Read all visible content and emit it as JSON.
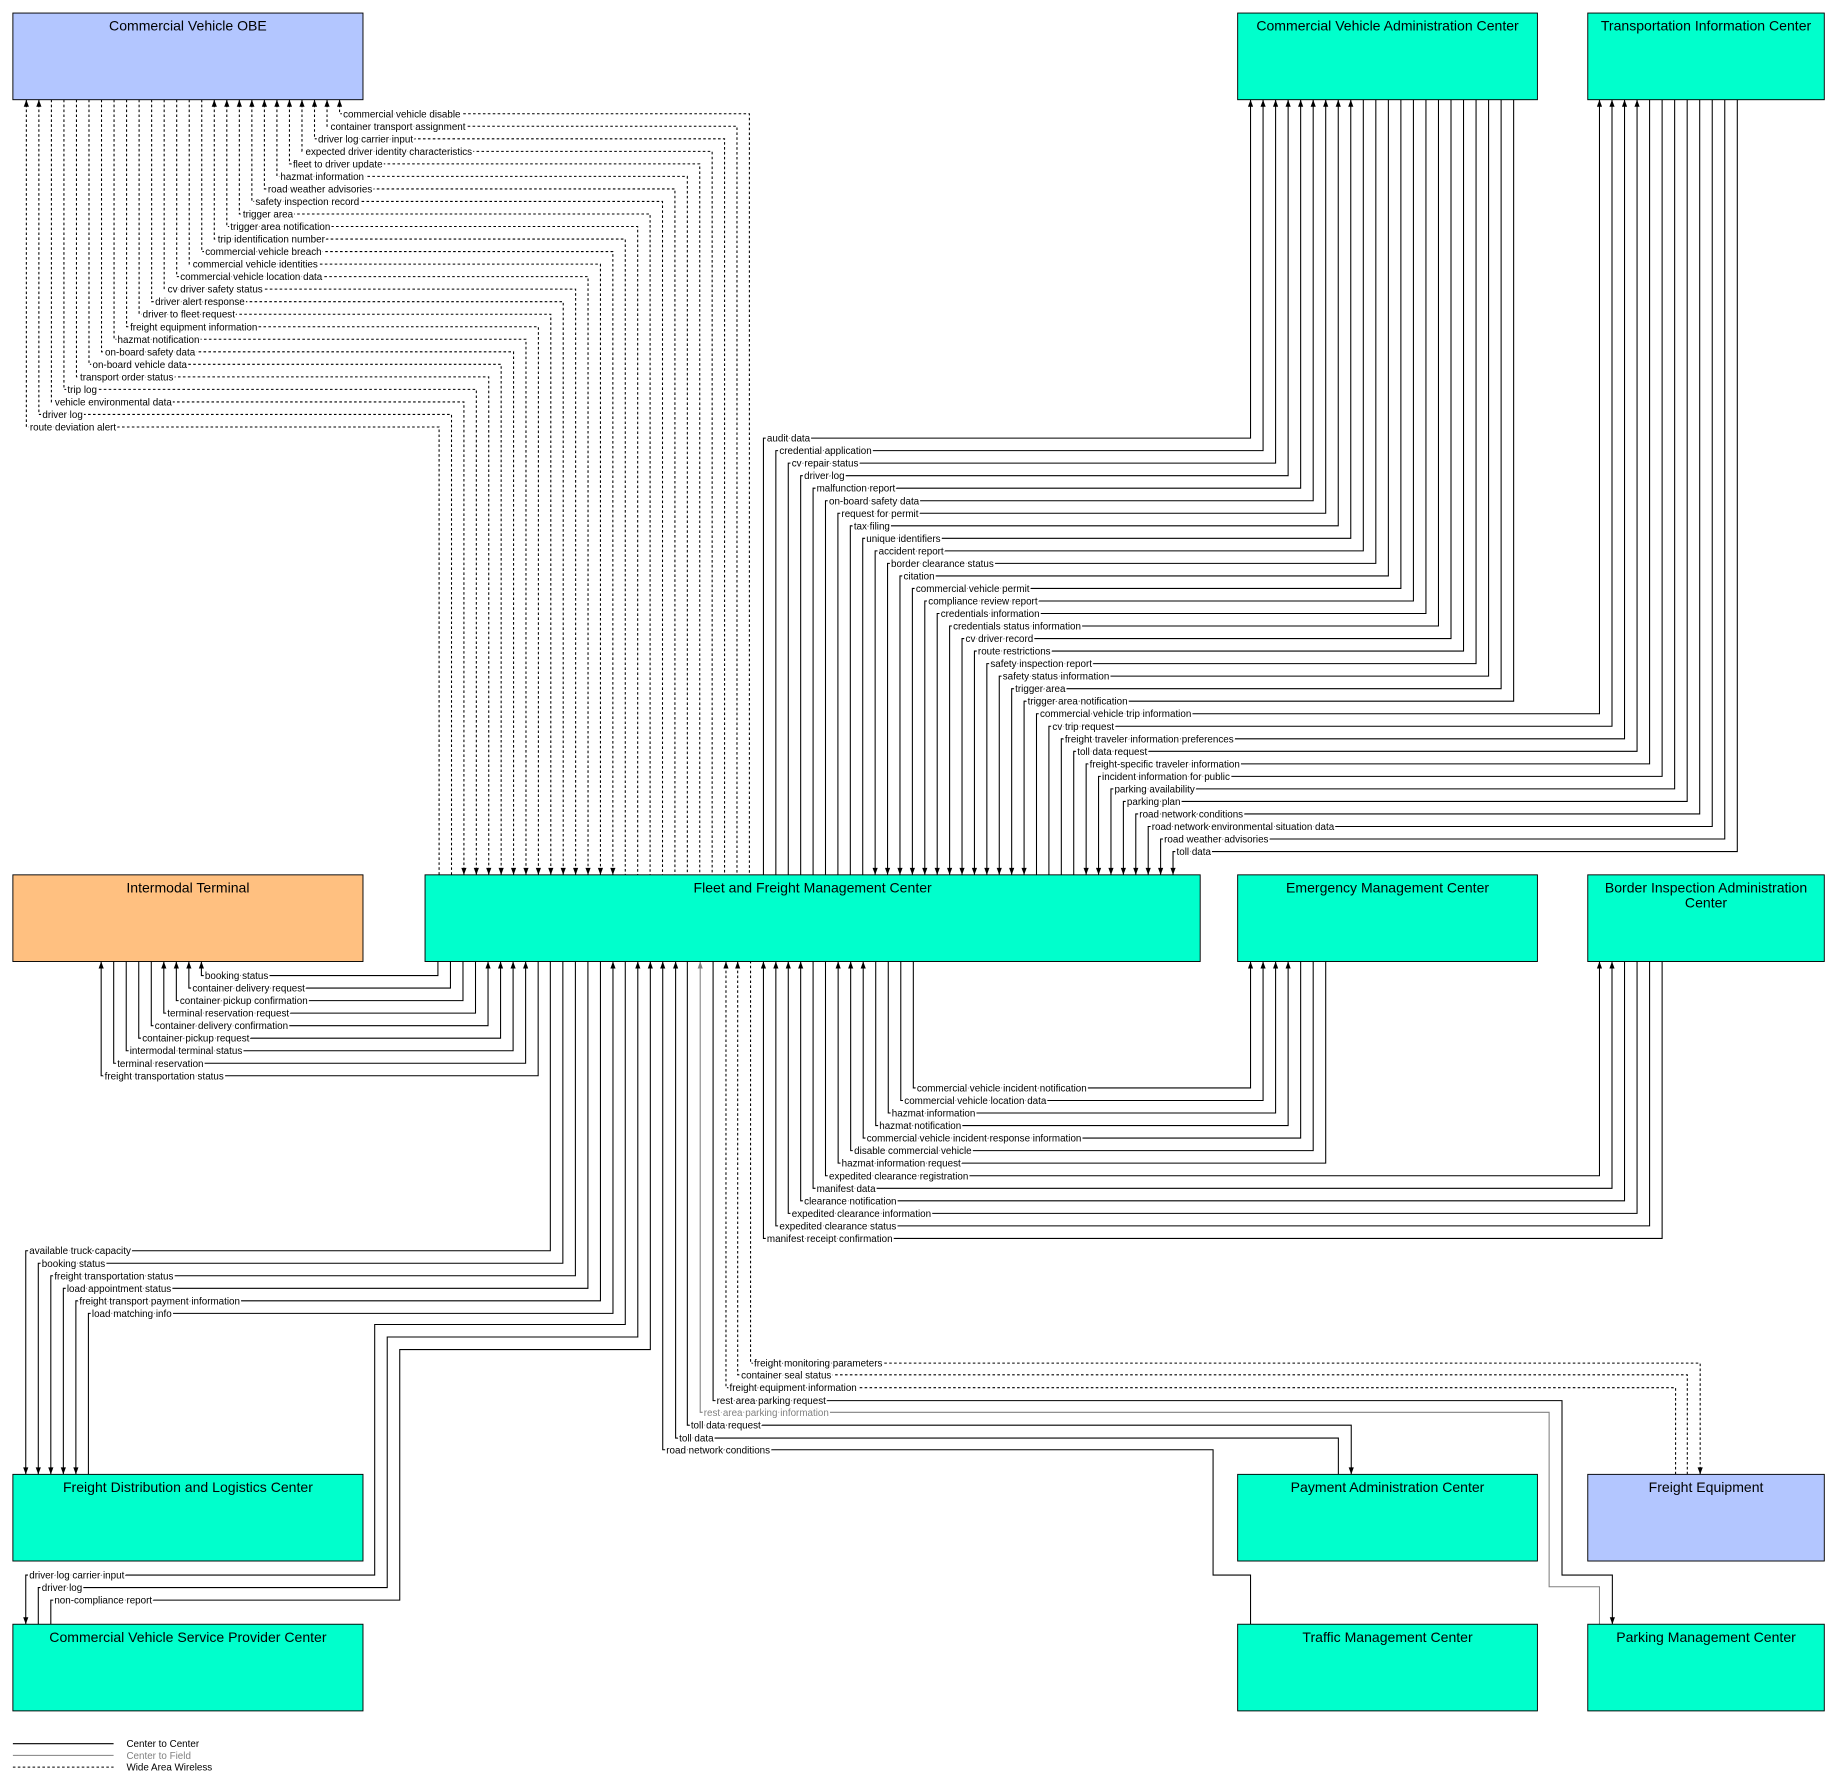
{
  "line_colors": {
    "ctc": "#000000",
    "ctf": "#808080",
    "waw": "#000000"
  },
  "nodes": {
    "cvobe": {
      "name": "Commercial Vehicle OBE",
      "color": "#b3c6ff"
    },
    "cvac": {
      "name": "Commercial Vehicle Administration Center",
      "color": "#00ffcc"
    },
    "tic": {
      "name": "Transportation Information Center",
      "color": "#00ffcc"
    },
    "it": {
      "name": "Intermodal Terminal",
      "color": "#ffc080"
    },
    "ffmc": {
      "name": "Fleet and Freight Management Center",
      "color": "#00ffcc"
    },
    "emc": {
      "name": "Emergency Management Center",
      "color": "#00ffcc"
    },
    "biac": {
      "name": "Border Inspection Administration Center",
      "color": "#00ffcc"
    },
    "fdlc": {
      "name": "Freight Distribution and Logistics Center",
      "color": "#00ffcc"
    },
    "pac": {
      "name": "Payment Administration Center",
      "color": "#00ffcc"
    },
    "fe": {
      "name": "Freight Equipment",
      "color": "#b3c6ff"
    },
    "cvspc": {
      "name": "Commercial Vehicle Service Provider Center",
      "color": "#00ffcc"
    },
    "tmc": {
      "name": "Traffic Management Center",
      "color": "#00ffcc"
    },
    "pmc": {
      "name": "Parking Management Center",
      "color": "#00ffcc"
    }
  },
  "groups": {
    "cvobe": [
      {
        "label": "commercial vehicle disable",
        "to": "cvobe",
        "type": "waw"
      },
      {
        "label": "container transport assignment",
        "to": "cvobe",
        "type": "waw"
      },
      {
        "label": "driver log carrier input",
        "to": "cvobe",
        "type": "waw"
      },
      {
        "label": "expected driver identity characteristics",
        "to": "cvobe",
        "type": "waw"
      },
      {
        "label": "fleet to driver update",
        "to": "cvobe",
        "type": "waw"
      },
      {
        "label": "hazmat information",
        "to": "cvobe",
        "type": "waw"
      },
      {
        "label": "road weather advisories",
        "to": "cvobe",
        "type": "waw"
      },
      {
        "label": "safety inspection record",
        "to": "cvobe",
        "type": "waw"
      },
      {
        "label": "trigger area",
        "to": "cvobe",
        "type": "waw"
      },
      {
        "label": "trigger area notification",
        "to": "cvobe",
        "type": "waw"
      },
      {
        "label": "trip identification number",
        "to": "cvobe",
        "type": "waw"
      },
      {
        "label": "commercial vehicle breach",
        "to": "ffmc",
        "type": "waw"
      },
      {
        "label": "commercial vehicle identities",
        "to": "ffmc",
        "type": "waw"
      },
      {
        "label": "commercial vehicle location data",
        "to": "ffmc",
        "type": "waw"
      },
      {
        "label": "cv driver safety status",
        "to": "ffmc",
        "type": "waw"
      },
      {
        "label": "driver alert response",
        "to": "ffmc",
        "type": "waw"
      },
      {
        "label": "driver to fleet request",
        "to": "ffmc",
        "type": "waw"
      },
      {
        "label": "freight equipment information",
        "to": "ffmc",
        "type": "waw"
      },
      {
        "label": "hazmat notification",
        "to": "ffmc",
        "type": "waw"
      },
      {
        "label": "on-board safety data",
        "to": "ffmc",
        "type": "waw"
      },
      {
        "label": "on-board vehicle data",
        "to": "ffmc",
        "type": "waw"
      },
      {
        "label": "transport order status",
        "to": "ffmc",
        "type": "waw"
      },
      {
        "label": "trip log",
        "to": "ffmc",
        "type": "waw"
      },
      {
        "label": "vehicle environmental data",
        "to": "ffmc",
        "type": "waw"
      },
      {
        "label": "driver log",
        "to": "cvobe",
        "type": "waw"
      },
      {
        "label": "route deviation alert",
        "to": "cvobe",
        "type": "waw"
      }
    ],
    "cvac_tic": [
      {
        "label": "audit data",
        "to": "cvac",
        "type": "ctc"
      },
      {
        "label": "credential application",
        "to": "cvac",
        "type": "ctc"
      },
      {
        "label": "cv repair status",
        "to": "cvac",
        "type": "ctc"
      },
      {
        "label": "driver log",
        "to": "cvac",
        "type": "ctc"
      },
      {
        "label": "malfunction report",
        "to": "cvac",
        "type": "ctc"
      },
      {
        "label": "on-board safety data",
        "to": "cvac",
        "type": "ctc"
      },
      {
        "label": "request for permit",
        "to": "cvac",
        "type": "ctc"
      },
      {
        "label": "tax filing",
        "to": "cvac",
        "type": "ctc"
      },
      {
        "label": "unique identifiers",
        "to": "cvac",
        "type": "ctc"
      },
      {
        "label": "accident report",
        "to": "ffmc",
        "type": "ctc"
      },
      {
        "label": "border clearance status",
        "to": "ffmc",
        "type": "ctc"
      },
      {
        "label": "citation",
        "to": "ffmc",
        "type": "ctc"
      },
      {
        "label": "commercial vehicle permit",
        "to": "ffmc",
        "type": "ctc"
      },
      {
        "label": "compliance review report",
        "to": "ffmc",
        "type": "ctc"
      },
      {
        "label": "credentials information",
        "to": "ffmc",
        "type": "ctc"
      },
      {
        "label": "credentials status information",
        "to": "ffmc",
        "type": "ctc"
      },
      {
        "label": "cv driver record",
        "to": "ffmc",
        "type": "ctc"
      },
      {
        "label": "route restrictions",
        "to": "ffmc",
        "type": "ctc"
      },
      {
        "label": "safety inspection report",
        "to": "ffmc",
        "type": "ctc"
      },
      {
        "label": "safety status information",
        "to": "ffmc",
        "type": "ctc"
      },
      {
        "label": "trigger area",
        "to": "ffmc",
        "type": "ctc"
      },
      {
        "label": "trigger area notification",
        "to": "ffmc",
        "type": "ctc"
      },
      {
        "label": "commercial vehicle trip information",
        "to": "tic",
        "type": "ctc"
      },
      {
        "label": "cv trip request",
        "to": "tic",
        "type": "ctc"
      },
      {
        "label": "freight traveler information preferences",
        "to": "tic",
        "type": "ctc"
      },
      {
        "label": "toll data request",
        "to": "tic",
        "type": "ctc"
      },
      {
        "label": "freight-specific traveler information",
        "to": "ffmc",
        "type": "ctc"
      },
      {
        "label": "incident information for public",
        "to": "ffmc",
        "type": "ctc"
      },
      {
        "label": "parking availability",
        "to": "ffmc",
        "type": "ctc"
      },
      {
        "label": "parking plan",
        "to": "ffmc",
        "type": "ctc"
      },
      {
        "label": "road network conditions",
        "to": "ffmc",
        "type": "ctc"
      },
      {
        "label": "road network environmental situation data",
        "to": "ffmc",
        "type": "ctc"
      },
      {
        "label": "road weather advisories",
        "to": "ffmc",
        "type": "ctc"
      },
      {
        "label": "toll data",
        "to": "ffmc",
        "type": "ctc"
      }
    ],
    "it": [
      {
        "label": "booking status",
        "to": "it",
        "type": "ctc"
      },
      {
        "label": "container delivery request",
        "to": "it",
        "type": "ctc"
      },
      {
        "label": "container pickup confirmation",
        "to": "it",
        "type": "ctc"
      },
      {
        "label": "terminal reservation request",
        "to": "it",
        "type": "ctc"
      },
      {
        "label": "container delivery confirmation",
        "to": "ffmc",
        "type": "ctc"
      },
      {
        "label": "container pickup request",
        "to": "ffmc",
        "type": "ctc"
      },
      {
        "label": "intermodal terminal status",
        "to": "ffmc",
        "type": "ctc"
      },
      {
        "label": "terminal reservation",
        "to": "ffmc",
        "type": "ctc"
      },
      {
        "label": "freight transportation status",
        "to": "it",
        "type": "ctc"
      }
    ],
    "emc": [
      {
        "label": "commercial vehicle incident notification",
        "to": "emc",
        "type": "ctc"
      },
      {
        "label": "commercial vehicle location data",
        "to": "emc",
        "type": "ctc"
      },
      {
        "label": "hazmat information",
        "to": "emc",
        "type": "ctc"
      },
      {
        "label": "hazmat notification",
        "to": "emc",
        "type": "ctc"
      },
      {
        "label": "commercial vehicle incident response information",
        "to": "ffmc",
        "type": "ctc"
      },
      {
        "label": "disable commercial vehicle",
        "to": "ffmc",
        "type": "ctc"
      },
      {
        "label": "hazmat information request",
        "to": "ffmc",
        "type": "ctc"
      }
    ],
    "biac": [
      {
        "label": "expedited clearance registration",
        "to": "biac",
        "type": "ctc"
      },
      {
        "label": "manifest data",
        "to": "biac",
        "type": "ctc"
      },
      {
        "label": "clearance notification",
        "to": "ffmc",
        "type": "ctc"
      },
      {
        "label": "expedited clearance information",
        "to": "ffmc",
        "type": "ctc"
      },
      {
        "label": "expedited clearance status",
        "to": "ffmc",
        "type": "ctc"
      },
      {
        "label": "manifest receipt confirmation",
        "to": "ffmc",
        "type": "ctc"
      }
    ],
    "fdlc": [
      {
        "label": "available truck capacity",
        "to": "fdlc",
        "type": "ctc"
      },
      {
        "label": "booking status",
        "to": "fdlc",
        "type": "ctc"
      },
      {
        "label": "freight transportation status",
        "to": "fdlc",
        "type": "ctc"
      },
      {
        "label": "load appointment status",
        "to": "fdlc",
        "type": "ctc"
      },
      {
        "label": "freight transport payment information",
        "to": "fdlc",
        "type": "ctc"
      },
      {
        "label": "load matching info",
        "to": "ffmc",
        "type": "ctc"
      }
    ],
    "cvspc": [
      {
        "label": "driver log carrier input",
        "to": "cvspc",
        "type": "ctc"
      },
      {
        "label": "driver log",
        "to": "ffmc",
        "type": "ctc"
      },
      {
        "label": "non-compliance report",
        "to": "ffmc",
        "type": "ctc"
      }
    ],
    "bottom": [
      {
        "label": "freight monitoring parameters",
        "other": "fe",
        "to": "fe",
        "type": "waw"
      },
      {
        "label": "container seal status",
        "other": "fe",
        "to": "ffmc",
        "type": "waw"
      },
      {
        "label": "freight equipment information",
        "other": "fe",
        "to": "ffmc",
        "type": "waw"
      },
      {
        "label": "rest area parking request",
        "other": "pmc",
        "to": "pmc",
        "type": "ctc"
      },
      {
        "label": "rest area parking information",
        "other": "pmc",
        "to": "ffmc",
        "type": "ctf"
      },
      {
        "label": "toll data request",
        "other": "pac",
        "to": "pac",
        "type": "ctc"
      },
      {
        "label": "toll data",
        "other": "pac",
        "to": "ffmc",
        "type": "ctc"
      },
      {
        "label": "road network conditions",
        "other": "tmc",
        "to": "ffmc",
        "type": "ctc"
      }
    ]
  },
  "legend": [
    {
      "label": "Center to Center",
      "type": "ctc"
    },
    {
      "label": "Center to Field",
      "type": "ctf"
    },
    {
      "label": "Wide Area Wireless",
      "type": "waw"
    }
  ]
}
